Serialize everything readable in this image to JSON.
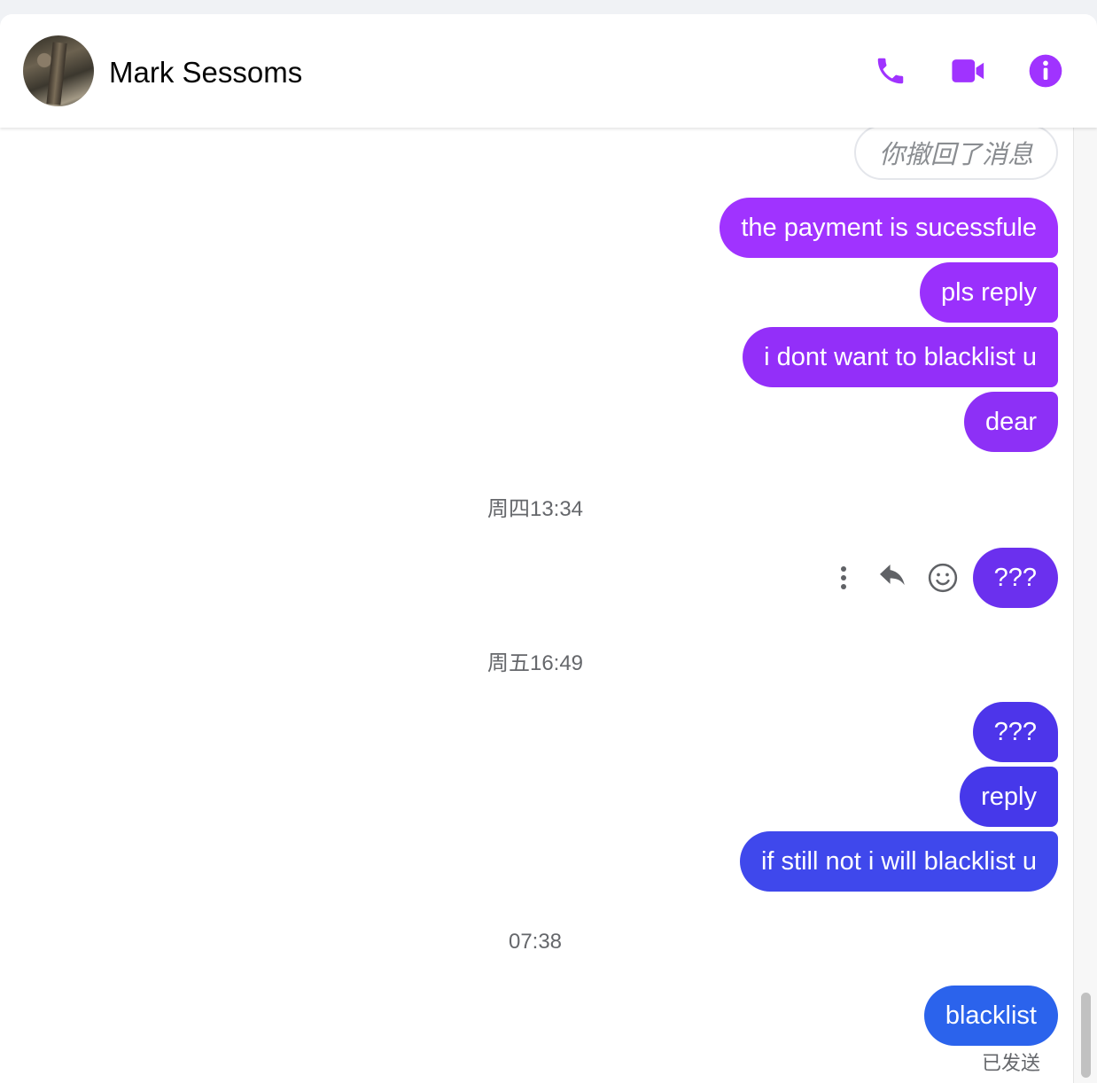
{
  "header": {
    "contact_name": "Mark Sessoms",
    "icons": [
      "phone-icon",
      "video-icon",
      "info-icon"
    ],
    "accent_color": "#a033ff"
  },
  "messages": {
    "unsent_notice": "你撤回了消息",
    "group1": [
      "the payment is sucessfule",
      "pls reply",
      "i dont want to blacklist u",
      "dear"
    ],
    "ts1": "周四13:34",
    "group2": [
      "???"
    ],
    "ts2": "周五16:49",
    "group3": [
      "???",
      "reply",
      "if still not i will blacklist u"
    ],
    "ts3": "07:38",
    "group4": [
      "blacklist"
    ],
    "status": "已发送"
  },
  "hover_actions": [
    "more-options-icon",
    "reply-icon",
    "react-emoji-icon"
  ]
}
